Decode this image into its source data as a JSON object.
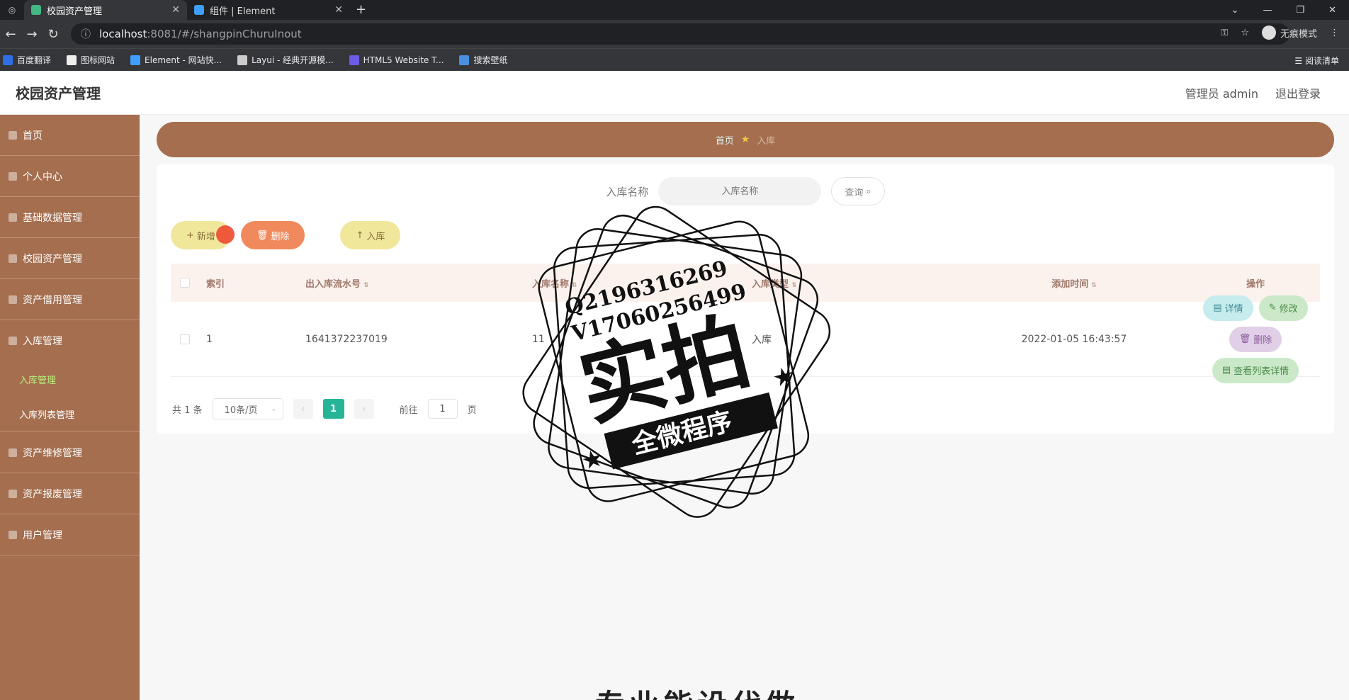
{
  "browser": {
    "tabs": [
      {
        "title": "校园资产管理",
        "active": true,
        "color": "#42b883"
      },
      {
        "title": "组件 | Element",
        "active": false,
        "color": "#409eff"
      }
    ],
    "url_host": "localhost",
    "url_path": ":8081/#/shangpinChuruInout",
    "incognito_label": "无痕模式",
    "bookmarks": [
      {
        "label": "百度翻译",
        "color": "#2e6fe5"
      },
      {
        "label": "图标网站",
        "color": "#eeeeee"
      },
      {
        "label": "Element - 网站快...",
        "color": "#409eff"
      },
      {
        "label": "Layui - 经典开源模...",
        "color": "#cccccc"
      },
      {
        "label": "HTML5 Website T...",
        "color": "#6c5ce7"
      },
      {
        "label": "搜索壁纸",
        "color": "#4a90e2"
      }
    ],
    "reading_list": "阅读清单"
  },
  "header": {
    "title": "校园资产管理",
    "user": "管理员 admin",
    "logout": "退出登录"
  },
  "sidebar": {
    "items": [
      {
        "label": "首页"
      },
      {
        "label": "个人中心"
      },
      {
        "label": "基础数据管理"
      },
      {
        "label": "校园资产管理"
      },
      {
        "label": "资产借用管理"
      },
      {
        "label": "入库管理"
      }
    ],
    "sub_items": [
      {
        "label": "入库管理",
        "active": true
      },
      {
        "label": "入库列表管理",
        "active": false
      }
    ],
    "items_after": [
      {
        "label": "资产维修管理"
      },
      {
        "label": "资产报废管理"
      },
      {
        "label": "用户管理"
      }
    ]
  },
  "breadcrumb": {
    "home": "首页",
    "current": "入库"
  },
  "search": {
    "label": "入库名称",
    "placeholder": "入库名称",
    "button": "查询"
  },
  "actions": {
    "add": "新增",
    "delete": "删除",
    "inbound": "入库"
  },
  "table": {
    "headers": [
      "索引",
      "出入库流水号",
      "入库名称",
      "入库类型",
      "添加时间",
      "操作"
    ],
    "rows": [
      {
        "index": "1",
        "serial": "1641372237019",
        "name": "11",
        "type": "入库",
        "time": "2022-01-05 16:43:57"
      }
    ],
    "ops": {
      "detail": "详情",
      "edit": "修改",
      "remove": "删除",
      "list_detail": "查看列表详情"
    }
  },
  "pagination": {
    "total": "共 1 条",
    "page_size": "10条/页",
    "current_page": "1",
    "goto_prefix": "前往",
    "goto_value": "1",
    "goto_suffix": "页"
  },
  "watermark": {
    "line1": "Q2196316269",
    "line2": "V17060256499",
    "big": "实拍",
    "banner": "全微程序"
  },
  "bottom_text": "专业能设代做"
}
